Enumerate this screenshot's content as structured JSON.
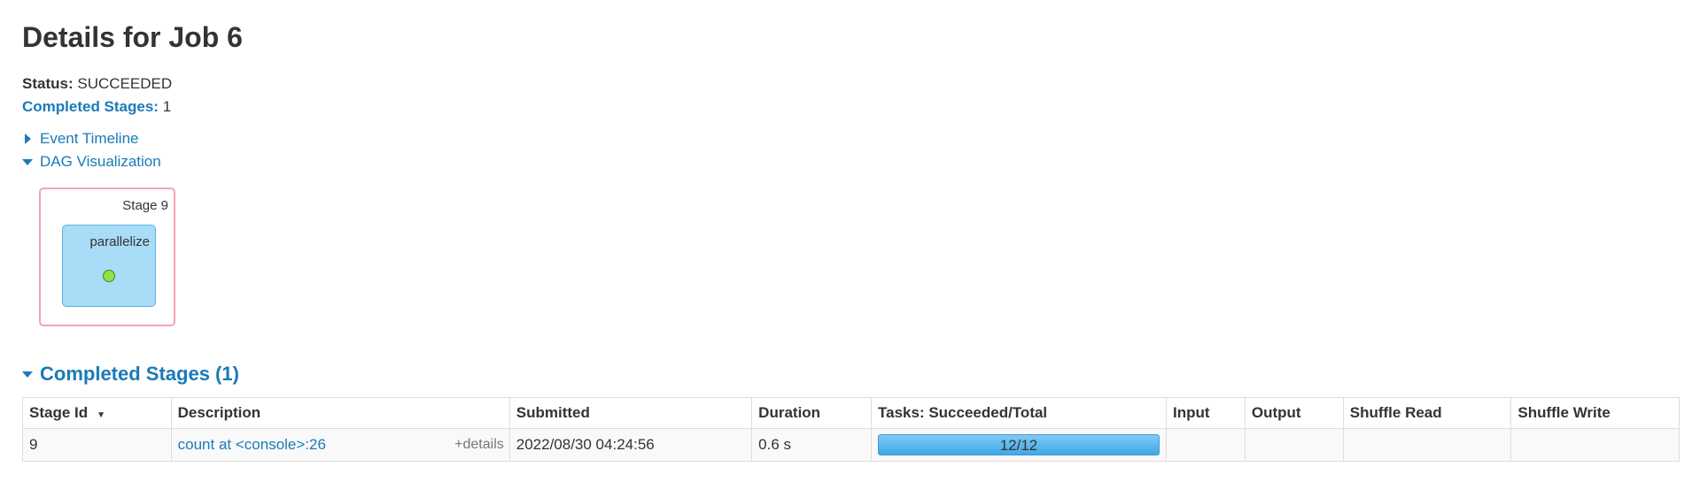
{
  "page": {
    "title": "Details for Job 6"
  },
  "summary": {
    "status_label": "Status:",
    "status_value": "SUCCEEDED",
    "completed_label": "Completed Stages:",
    "completed_value": "1"
  },
  "toggles": {
    "event_timeline": "Event Timeline",
    "dag_visualization": "DAG Visualization"
  },
  "dag": {
    "stage_label": "Stage 9",
    "rdd_label": "parallelize"
  },
  "completed_stages": {
    "header": "Completed Stages (1)",
    "columns": [
      "Stage Id",
      "Description",
      "Submitted",
      "Duration",
      "Tasks: Succeeded/Total",
      "Input",
      "Output",
      "Shuffle Read",
      "Shuffle Write"
    ],
    "rows": [
      {
        "stage_id": "9",
        "description": "count at <console>:26",
        "details": "+details",
        "submitted": "2022/08/30 04:24:56",
        "duration": "0.6 s",
        "tasks": "12/12",
        "tasks_fraction": 1.0,
        "input": "",
        "output": "",
        "shuffle_read": "",
        "shuffle_write": ""
      }
    ]
  },
  "colors": {
    "link": "#1a7ab8",
    "progress": "#3fa7e6",
    "stage_border": "#f4a5b2",
    "rdd_fill": "#a8dcf7"
  }
}
